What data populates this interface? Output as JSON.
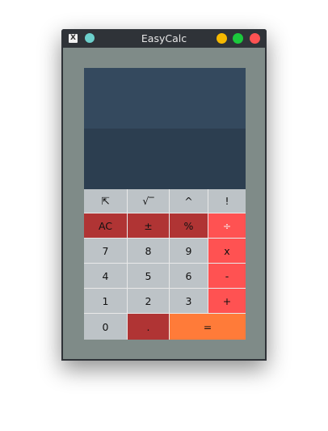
{
  "window": {
    "title": "EasyCalc",
    "app_icon_glyph": "X",
    "colors": {
      "pin": "#6cd0cc",
      "minimize": "#f6b900",
      "maximize": "#1bc93c",
      "close": "#ff5252",
      "display_top": "#34495e",
      "display_bottom": "#2c3e50",
      "key_gray": "#bdc3c7",
      "key_dark_red": "#b03434",
      "key_red": "#ff5252",
      "key_orange": "#ff7b39"
    }
  },
  "display": {
    "expression": "",
    "result": ""
  },
  "keys": {
    "collapse": "⇱",
    "sqrt": "√‾",
    "power": "^",
    "factorial": "!",
    "clear": "AC",
    "negate": "±",
    "percent": "%",
    "divide": "÷",
    "seven": "7",
    "eight": "8",
    "nine": "9",
    "multiply": "x",
    "four": "4",
    "five": "5",
    "six": "6",
    "subtract": "-",
    "one": "1",
    "two": "2",
    "three": "3",
    "add": "+",
    "zero": "0",
    "decimal": ".",
    "equals": "="
  }
}
